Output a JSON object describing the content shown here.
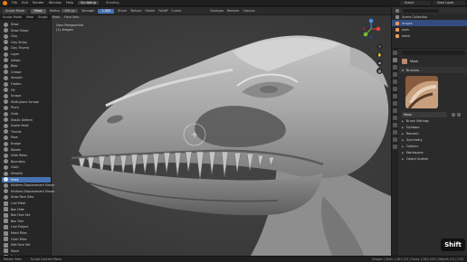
{
  "topbar": {
    "menus": [
      "File",
      "Edit",
      "Render",
      "Window",
      "Help"
    ],
    "workspaces": [
      {
        "label": "Sculpting",
        "active": true
      },
      {
        "label": "Shading",
        "active": false
      }
    ],
    "scene": "Scene",
    "view_layer": "View Layer"
  },
  "header": {
    "mode": "Sculpt Mode",
    "brush": "Mask",
    "radius_label": "Radius",
    "radius_value": "104 px",
    "strength_label": "Strength",
    "strength_value": "1.000",
    "menus": [
      "Brush",
      "Texture",
      "Stroke",
      "Falloff",
      "Cursor"
    ],
    "right_menus": [
      "Dyntopo",
      "Remesh",
      "Options"
    ]
  },
  "viewport_menu": [
    "Sculpt Mode",
    "View",
    "Sculpt",
    "Mask",
    "Face Sets"
  ],
  "viewport_overlay": {
    "line1": "User Perspective",
    "line2": "(1) dragon"
  },
  "toolbar": {
    "tools": [
      {
        "label": "Draw",
        "icon": "round"
      },
      {
        "label": "Draw Sharp",
        "icon": "round"
      },
      {
        "label": "Clay",
        "icon": "round"
      },
      {
        "label": "Clay Strips",
        "icon": "round"
      },
      {
        "label": "Clay Thumb",
        "icon": "round"
      },
      {
        "label": "Layer",
        "icon": "round"
      },
      {
        "label": "Inflate",
        "icon": "round"
      },
      {
        "label": "Blob",
        "icon": "round"
      },
      {
        "label": "Crease",
        "icon": "round"
      },
      {
        "label": "Smooth",
        "icon": "round"
      },
      {
        "label": "Flatten",
        "icon": "round"
      },
      {
        "label": "Fill",
        "icon": "round"
      },
      {
        "label": "Scrape",
        "icon": "round"
      },
      {
        "label": "Multi-plane Scrape",
        "icon": "round"
      },
      {
        "label": "Pinch",
        "icon": "round"
      },
      {
        "label": "Grab",
        "icon": "round"
      },
      {
        "label": "Elastic Deform",
        "icon": "round"
      },
      {
        "label": "Snake Hook",
        "icon": "round"
      },
      {
        "label": "Thumb",
        "icon": "round"
      },
      {
        "label": "Pose",
        "icon": "round"
      },
      {
        "label": "Nudge",
        "icon": "round"
      },
      {
        "label": "Rotate",
        "icon": "round"
      },
      {
        "label": "Slide Relax",
        "icon": "round"
      },
      {
        "label": "Boundary",
        "icon": "round"
      },
      {
        "label": "Cloth",
        "icon": "round"
      },
      {
        "label": "Simplify",
        "icon": "round"
      },
      {
        "label": "Mask",
        "icon": "round",
        "active": true
      },
      {
        "label": "Multires Displacement Eraser",
        "icon": "round"
      },
      {
        "label": "Multires Displacement Smear",
        "icon": "round"
      },
      {
        "label": "Draw Face Sets",
        "icon": "round"
      },
      {
        "label": "Line Mask",
        "icon": "square"
      },
      {
        "label": "Box Hide",
        "icon": "square"
      },
      {
        "label": "Box Face Set",
        "icon": "square"
      },
      {
        "label": "Box Trim",
        "icon": "square"
      },
      {
        "label": "Line Project",
        "icon": "square"
      },
      {
        "label": "Mesh Filter",
        "icon": "square"
      },
      {
        "label": "Cloth Filter",
        "icon": "square"
      },
      {
        "label": "Edit Face Set",
        "icon": "square"
      },
      {
        "label": "Move",
        "icon": "square"
      },
      {
        "label": "Rotate",
        "icon": "square"
      }
    ]
  },
  "outliner": {
    "rows": [
      {
        "label": "Scene Collection",
        "selected": false,
        "color": "#8c8c8c"
      },
      {
        "label": "dragon",
        "selected": true,
        "color": "#e59a5b"
      },
      {
        "label": "eyes",
        "selected": false,
        "color": "#e59a5b"
      },
      {
        "label": "teeth",
        "selected": false,
        "color": "#e59a5b"
      }
    ]
  },
  "properties": {
    "brush_name": "Mask",
    "brushes_header": "Brushes",
    "brush_field": "Mask",
    "panels": [
      "Brush Settings",
      "Dyntopo",
      "Remesh",
      "Symmetry",
      "Options",
      "Workspace",
      "Object Scatter"
    ]
  },
  "statusbar": {
    "items": [
      "Rotate View",
      "Sculpt Context Menu"
    ],
    "stats": "Dragon | Verts 1,261,113 | Faces 1,261,109 | Objects 1/3 | 2.93"
  },
  "key_badge": "Shift",
  "colors": {
    "accent": "#4772b3",
    "selected_row": "#334d80",
    "orange": "#e87d0d"
  }
}
